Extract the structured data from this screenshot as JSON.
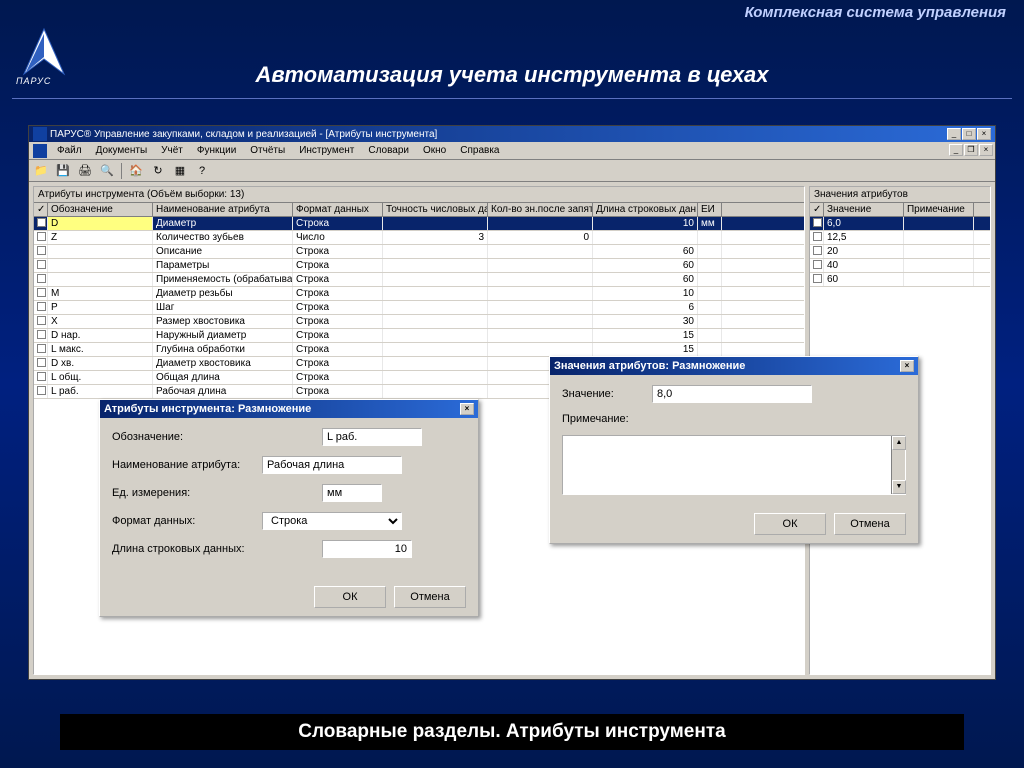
{
  "slide": {
    "system_name": "Комплексная система управления",
    "title": "Автоматизация учета инструмента в цехах",
    "footer": "Словарные разделы. Атрибуты инструмента",
    "brand": "ПАРУС"
  },
  "app": {
    "title": "ПАРУС® Управление закупками, складом и реализацией - [Атрибуты инструмента]",
    "menu": [
      "Файл",
      "Документы",
      "Учёт",
      "Функции",
      "Отчёты",
      "Инструмент",
      "Словари",
      "Окно",
      "Справка"
    ]
  },
  "left_panel": {
    "header": "Атрибуты инструмента (Объём выборки: 13)",
    "columns": [
      "Обозначение",
      "Наименование атрибута",
      "Формат данных",
      "Точность числовых да",
      "Кол-во зн.после запят",
      "Длина строковых дан",
      "ЕИ"
    ],
    "rows": [
      {
        "sel": true,
        "c": [
          "D",
          "Диаметр",
          "Строка",
          "",
          "",
          "10",
          "мм"
        ]
      },
      {
        "c": [
          "Z",
          "Количество зубьев",
          "Число",
          "3",
          "0",
          "",
          ""
        ]
      },
      {
        "c": [
          "",
          "Описание",
          "Строка",
          "",
          "",
          "60",
          ""
        ]
      },
      {
        "c": [
          "",
          "Параметры",
          "Строка",
          "",
          "",
          "60",
          ""
        ]
      },
      {
        "c": [
          "",
          "Применяемость (обрабатывае",
          "Строка",
          "",
          "",
          "60",
          ""
        ]
      },
      {
        "c": [
          "M",
          "Диаметр резьбы",
          "Строка",
          "",
          "",
          "10",
          ""
        ]
      },
      {
        "c": [
          "P",
          "Шаг",
          "Строка",
          "",
          "",
          "6",
          ""
        ]
      },
      {
        "c": [
          "X",
          "Размер хвостовика",
          "Строка",
          "",
          "",
          "30",
          ""
        ]
      },
      {
        "c": [
          "D нар.",
          "Наружный диаметр",
          "Строка",
          "",
          "",
          "15",
          ""
        ]
      },
      {
        "c": [
          "L макс.",
          "Глубина обработки",
          "Строка",
          "",
          "",
          "15",
          ""
        ]
      },
      {
        "c": [
          "D хв.",
          "Диаметр хвостовика",
          "Строка",
          "",
          "",
          "15",
          ""
        ]
      },
      {
        "c": [
          "L общ.",
          "Общая длина",
          "Строка",
          "",
          "",
          "15",
          ""
        ]
      },
      {
        "c": [
          "L раб.",
          "Рабочая длина",
          "Строка",
          "",
          "",
          "",
          ""
        ]
      }
    ]
  },
  "right_panel": {
    "header": "Значения атрибутов",
    "columns": [
      "Значение",
      "Примечание"
    ],
    "rows": [
      {
        "sel": true,
        "c": [
          "6,0",
          ""
        ]
      },
      {
        "c": [
          "12,5",
          ""
        ]
      },
      {
        "c": [
          "20",
          ""
        ]
      },
      {
        "c": [
          "40",
          ""
        ]
      },
      {
        "c": [
          "60",
          ""
        ]
      }
    ]
  },
  "dialog1": {
    "title": "Атрибуты инструмента: Размножение",
    "labels": {
      "designation": "Обозначение:",
      "attr_name": "Наименование атрибута:",
      "units": "Ед. измерения:",
      "format": "Формат данных:",
      "length": "Длина строковых данных:"
    },
    "values": {
      "designation": "L раб.",
      "attr_name": "Рабочая длина",
      "units": "мм",
      "format": "Строка",
      "length": "10"
    },
    "ok": "ОК",
    "cancel": "Отмена"
  },
  "dialog2": {
    "title": "Значения атрибутов: Размножение",
    "labels": {
      "value": "Значение:",
      "note": "Примечание:"
    },
    "values": {
      "value": "8,0"
    },
    "ok": "ОК",
    "cancel": "Отмена"
  }
}
